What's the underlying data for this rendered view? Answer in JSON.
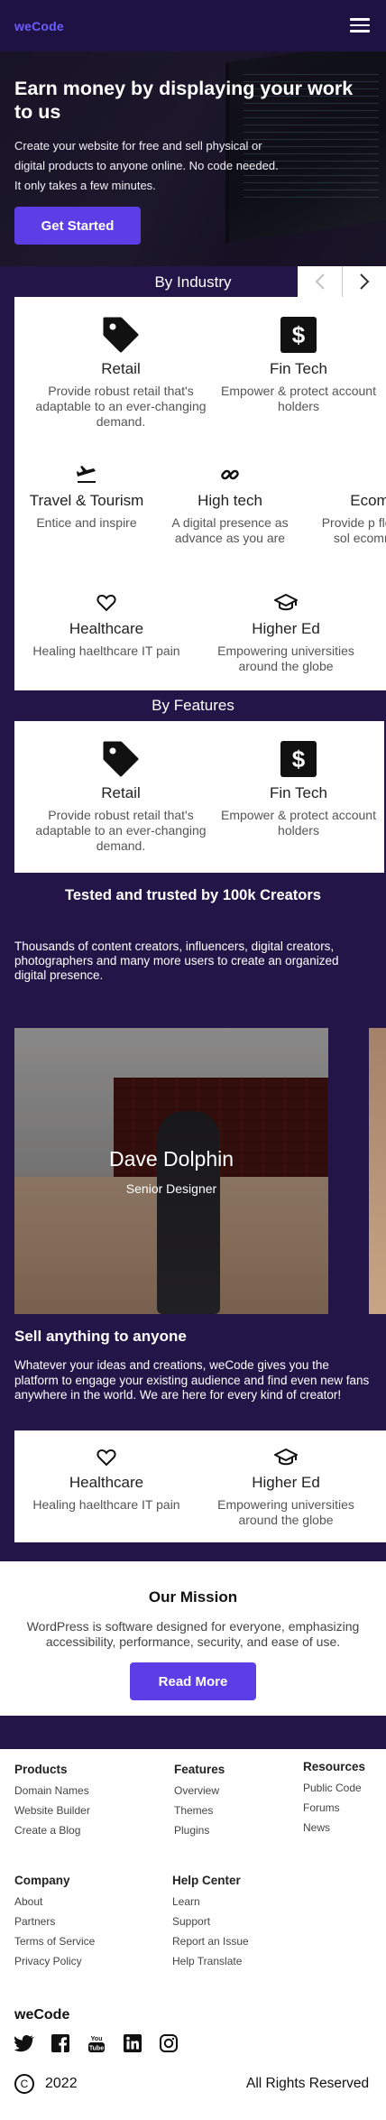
{
  "header": {
    "logo": "weCode",
    "menu_icon": "hamburger-menu-icon"
  },
  "hero": {
    "title": "Earn money by displaying your work to us",
    "subtitle": "Create your website for free and sell physical or digital products to anyone online. No code needed. It only takes a few minutes.",
    "cta_label": "Get Started"
  },
  "industry": {
    "title": "By Industry",
    "prev_icon": "chevron-left-icon",
    "next_icon": "chevron-right-icon",
    "cards": [
      {
        "title": "Retail",
        "desc": "Provide robust retail that's adaptable to an ever-changing demand.",
        "icon": "tag-icon"
      },
      {
        "title": "Fin Tech",
        "desc": "Empower & protect account holders",
        "icon": "dollar-icon"
      },
      {
        "title": "Travel & Tourism",
        "desc": "Entice and inspire",
        "icon": "airplane-icon"
      },
      {
        "title": "High tech",
        "desc": "A digital presence as advance as you are",
        "icon": "link-icon"
      },
      {
        "title": "Ecom",
        "desc": "Provide p flexible sol ecommer",
        "icon": ""
      },
      {
        "title": "Healthcare",
        "desc": "Healing haelthcare IT pain",
        "icon": "heart-icon"
      },
      {
        "title": "Higher Ed",
        "desc": "Empowering universities around the globe",
        "icon": "graduation-cap-icon"
      }
    ]
  },
  "features": {
    "title": "By Features",
    "cards": [
      {
        "title": "Retail",
        "desc": "Provide robust retail that's adaptable to an ever-changing demand.",
        "icon": "tag-icon"
      },
      {
        "title": "Fin Tech",
        "desc": "Empower & protect account holders",
        "icon": "dollar-icon"
      }
    ]
  },
  "tested": {
    "title": "Tested and trusted by 100k Creators",
    "subtitle": "Thousands of content creators, influencers, digital creators, photographers and many more users to create an organized digital presence."
  },
  "testimonial": {
    "name": "Dave Dolphin",
    "role": "Senior Designer"
  },
  "sell": {
    "title": "Sell anything to anyone",
    "text": "Whatever your ideas and creations, weCode gives you the platform to engage your existing audience and find even new fans anywhere in the world. We are here for every kind of creator!",
    "cards": [
      {
        "title": "Healthcare",
        "desc": "Healing haelthcare IT pain",
        "icon": "heart-icon"
      },
      {
        "title": "Higher Ed",
        "desc": "Empowering universities around the globe",
        "icon": "graduation-cap-icon"
      }
    ]
  },
  "mission": {
    "title": "Our Mission",
    "text": "WordPress is software designed for everyone, emphasizing accessibility, performance, security, and ease of use.",
    "cta_label": "Read More"
  },
  "footer": {
    "products": {
      "title": "Products",
      "links": [
        "Domain Names",
        "Website Builder",
        "Create a Blog"
      ]
    },
    "features": {
      "title": "Features",
      "links": [
        "Overview",
        "Themes",
        "Plugins"
      ]
    },
    "resources": {
      "title": "Resources",
      "links": [
        "Public Code",
        "Forums",
        "News"
      ]
    },
    "company": {
      "title": "Company",
      "links": [
        "About",
        "Partners",
        "Terms of Service",
        "Privacy Policy"
      ]
    },
    "help": {
      "title": "Help Center",
      "links": [
        "Learn",
        "Support",
        "Report an Issue",
        "Help Translate"
      ]
    },
    "brand": "weCode",
    "socials": [
      "twitter-icon",
      "facebook-icon",
      "youtube-icon",
      "linkedin-icon",
      "instagram-icon"
    ],
    "year": "2022",
    "rights": "All Rights Reserved"
  },
  "colors": {
    "brand_dark": "#231548",
    "accent": "#5b3ee6",
    "logo": "#6d5dfc"
  }
}
